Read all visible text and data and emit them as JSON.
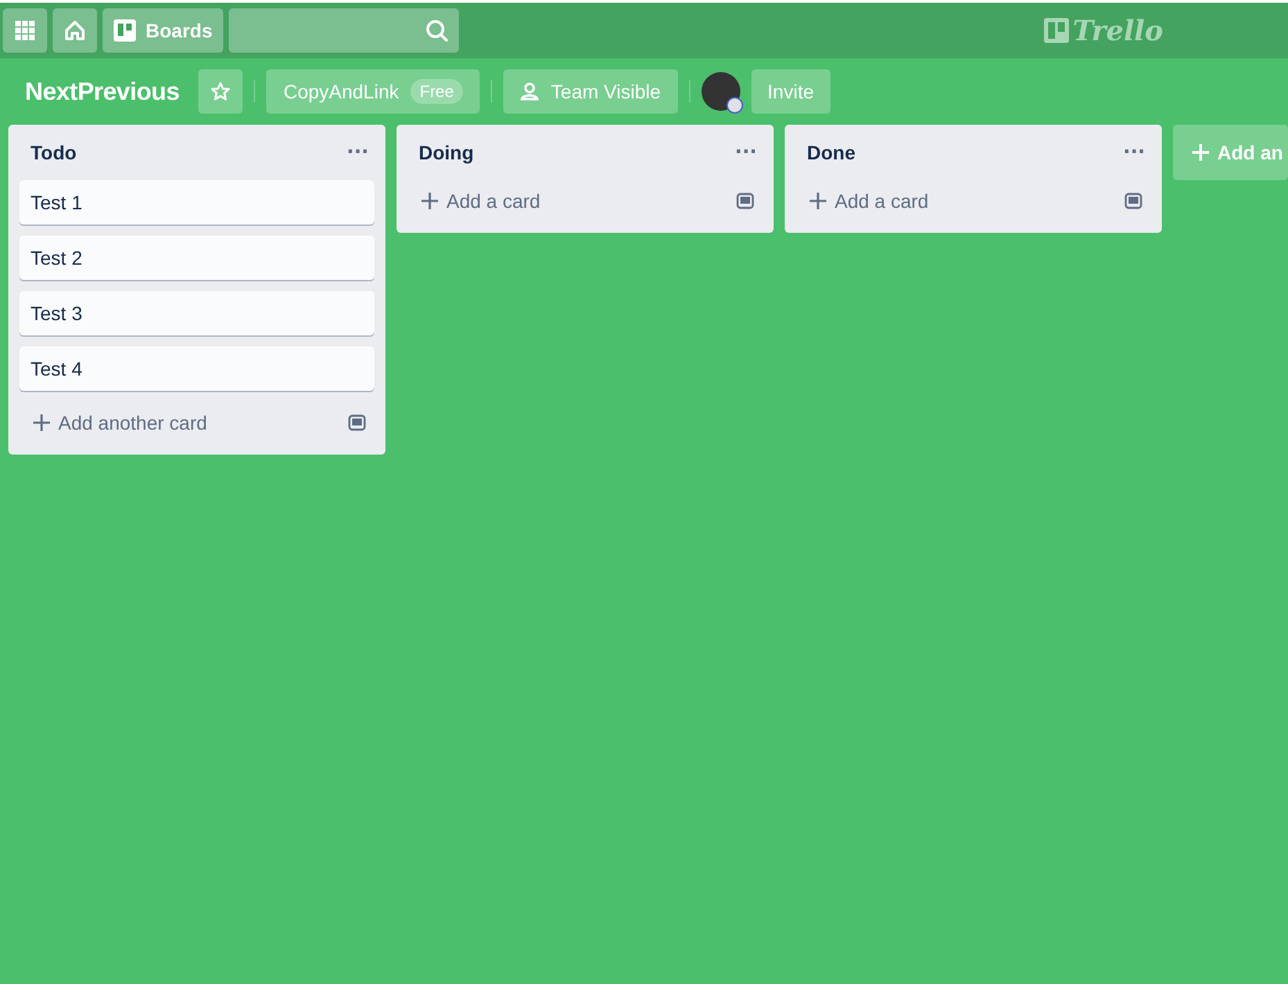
{
  "header": {
    "boards_label": "Boards",
    "logo_text": "Trello"
  },
  "board_bar": {
    "title": "NextPrevious",
    "starred": false,
    "team": "CopyAndLink",
    "team_badge": "Free",
    "visibility": "Team Visible",
    "invite": "Invite"
  },
  "lists": [
    {
      "title": "Todo",
      "menu": "···",
      "cards": [
        "Test 1",
        "Test 2",
        "Test 3",
        "Test 4"
      ],
      "add_label": "Add another card"
    },
    {
      "title": "Doing",
      "menu": "···",
      "add_label": "Add a card"
    },
    {
      "title": "Done",
      "menu": "···",
      "add_label": "Add a card"
    }
  ],
  "add_list": "Add an"
}
